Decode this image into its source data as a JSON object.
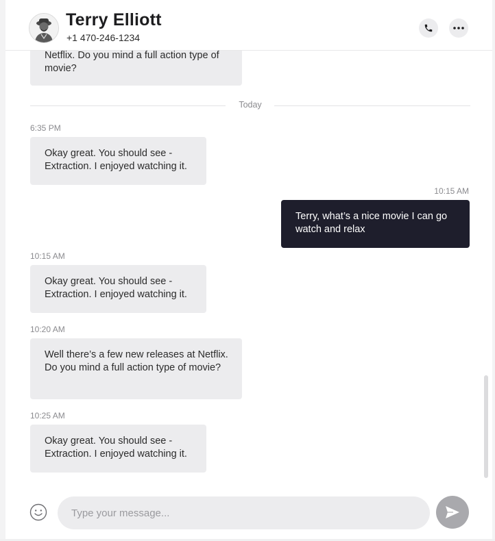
{
  "contact": {
    "name": "Terry Elliott",
    "phone": "+1 470-246-1234",
    "avatar_icon": "user-avatar"
  },
  "header_actions": [
    {
      "icon": "phone-icon"
    },
    {
      "icon": "more-horizontal-icon"
    }
  ],
  "day_separator": "Today",
  "messages": [
    {
      "text": "Netflix. Do you mind a full action type of movie?",
      "direction": "incoming"
    },
    {
      "time": "6:35 PM",
      "text": "Okay great. You should see - Extraction. I enjoyed watching it.",
      "direction": "incoming"
    },
    {
      "time": "10:15 AM",
      "text": "Terry, what’s a nice movie I can go watch and relax",
      "direction": "outgoing"
    },
    {
      "time": "10:15 AM",
      "text": "Okay great. You should see - Extraction. I enjoyed watching it.",
      "direction": "incoming"
    },
    {
      "time": "10:20 AM",
      "text": "Well there’s a few new releases at Netflix. Do you mind a full action type of movie?",
      "direction": "incoming"
    },
    {
      "time": "10:25 AM",
      "text": "Okay great. You should see - Extraction. I enjoyed watching it.",
      "direction": "incoming"
    }
  ],
  "composer": {
    "placeholder": "Type your message...",
    "value": "",
    "emoji_icon": "smiley-icon",
    "send_icon": "send-icon"
  },
  "colors": {
    "outgoing_bubble": "#1e1e2c",
    "incoming_bubble": "#ececee",
    "send_button": "#a9a9ad"
  }
}
